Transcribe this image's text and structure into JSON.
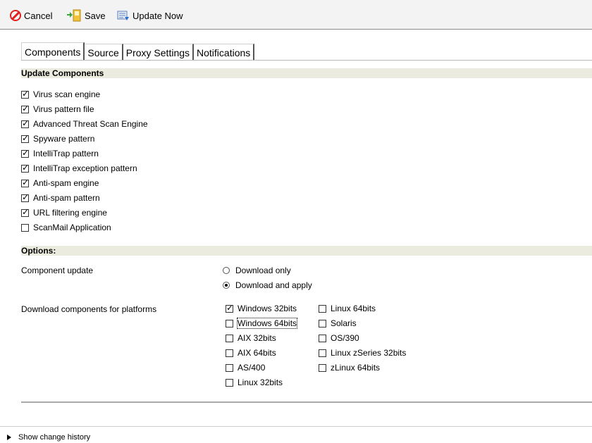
{
  "toolbar": {
    "cancel_label": "Cancel",
    "save_label": "Save",
    "update_now_label": "Update Now"
  },
  "tabs": [
    {
      "label": "Components",
      "active": true
    },
    {
      "label": "Source",
      "active": false
    },
    {
      "label": "Proxy Settings",
      "active": false
    },
    {
      "label": "Notifications",
      "active": false
    }
  ],
  "update_components": {
    "heading": "Update Components",
    "items": [
      {
        "label": "Virus scan engine",
        "checked": true
      },
      {
        "label": "Virus pattern file",
        "checked": true
      },
      {
        "label": "Advanced Threat Scan Engine",
        "checked": true
      },
      {
        "label": "Spyware pattern",
        "checked": true
      },
      {
        "label": "IntelliTrap pattern",
        "checked": true
      },
      {
        "label": "IntelliTrap exception pattern",
        "checked": true
      },
      {
        "label": "Anti-spam engine",
        "checked": true
      },
      {
        "label": "Anti-spam pattern",
        "checked": true
      },
      {
        "label": "URL filtering engine",
        "checked": true
      },
      {
        "label": "ScanMail Application",
        "checked": false
      }
    ]
  },
  "options": {
    "heading": "Options:",
    "component_update_label": "Component update",
    "download_only_label": "Download only",
    "download_and_apply_label": "Download and apply",
    "selected_mode": "Download and apply",
    "platforms_label": "Download components for platforms",
    "platforms_col1": [
      {
        "label": "Windows 32bits",
        "checked": true
      },
      {
        "label": "Windows 64bits",
        "checked": false
      },
      {
        "label": "AIX 32bits",
        "checked": false
      },
      {
        "label": "AIX 64bits",
        "checked": false
      },
      {
        "label": "AS/400",
        "checked": false
      },
      {
        "label": "Linux 32bits",
        "checked": false
      }
    ],
    "platforms_col2": [
      {
        "label": "Linux 64bits",
        "checked": false
      },
      {
        "label": "Solaris",
        "checked": false
      },
      {
        "label": "OS/390",
        "checked": false
      },
      {
        "label": "Linux zSeries 32bits",
        "checked": false
      },
      {
        "label": "zLinux 64bits",
        "checked": false
      }
    ]
  },
  "footer": {
    "show_history_label": "Show change history"
  }
}
